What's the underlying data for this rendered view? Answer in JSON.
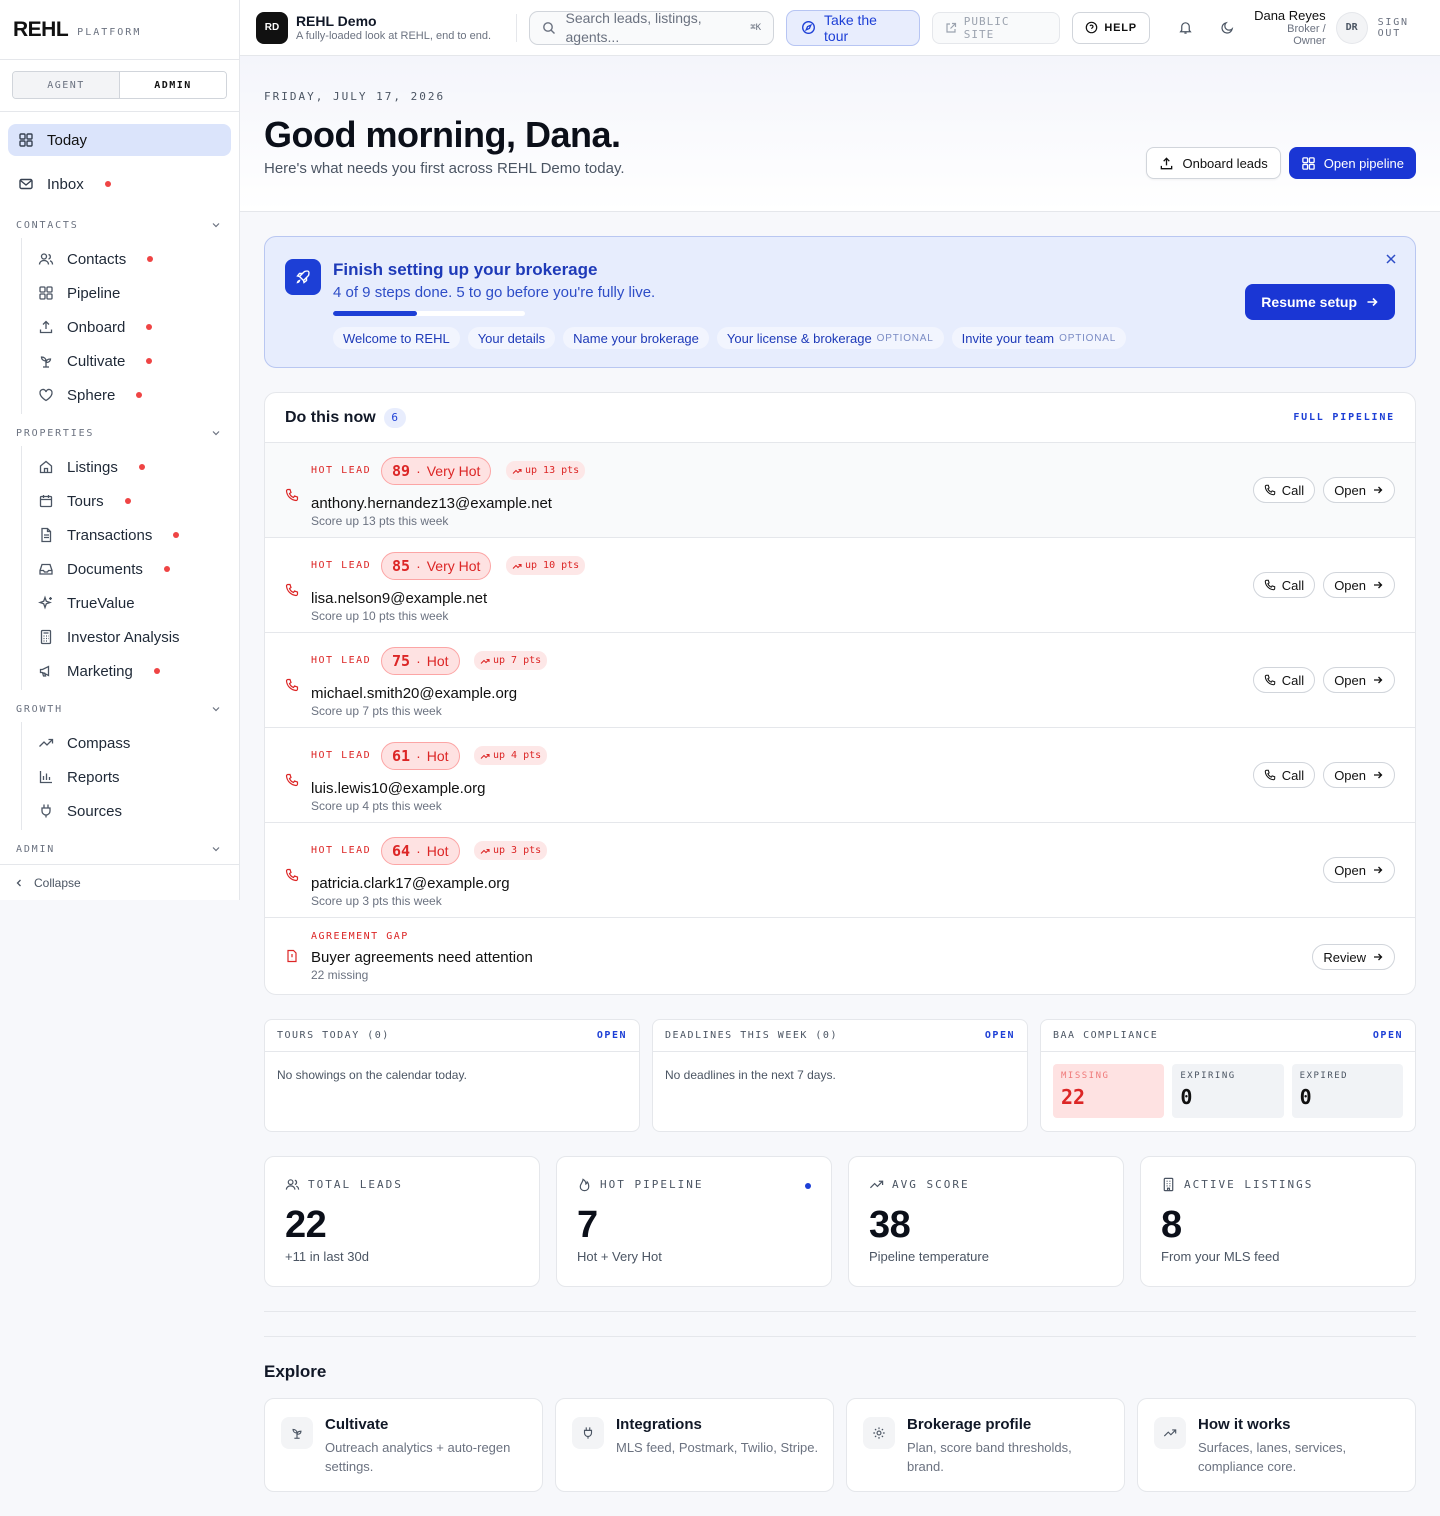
{
  "brand": {
    "logo": "REHL",
    "sub": "PLATFORM"
  },
  "role_toggle": {
    "agent": "AGENT",
    "admin": "ADMIN",
    "selected": "ADMIN"
  },
  "nav": {
    "today": "Today",
    "inbox": "Inbox",
    "sections": {
      "contacts": {
        "label": "CONTACTS",
        "items": [
          "Contacts",
          "Pipeline",
          "Onboard",
          "Cultivate",
          "Sphere"
        ]
      },
      "properties": {
        "label": "PROPERTIES",
        "items": [
          "Listings",
          "Tours",
          "Transactions",
          "Documents",
          "TrueValue",
          "Investor Analysis",
          "Marketing"
        ]
      },
      "growth": {
        "label": "GROWTH",
        "items": [
          "Compass",
          "Reports",
          "Sources"
        ]
      },
      "admin": {
        "label": "ADMIN"
      }
    },
    "collapse": "Collapse"
  },
  "topbar": {
    "org_initials": "RD",
    "org_name": "REHL Demo",
    "org_desc": "A fully-loaded look at REHL, end to end.",
    "search_placeholder": "Search leads, listings, agents...",
    "search_kbd": "⌘K",
    "tour": "Take the tour",
    "public_site": "PUBLIC SITE",
    "help": "HELP",
    "user_name": "Dana Reyes",
    "user_role": "Broker / Owner",
    "user_initials": "DR",
    "sign_out": "SIGN OUT"
  },
  "hero": {
    "date": "FRIDAY, JULY 17, 2026",
    "title": "Good morning, Dana.",
    "subtitle": "Here's what needs you first across REHL Demo today.",
    "onboard": "Onboard leads",
    "open_pipeline": "Open pipeline"
  },
  "setup": {
    "title": "Finish setting up your brokerage",
    "subtitle": "4 of 9 steps done. 5 to go before you're fully live.",
    "progress": 0.44,
    "resume": "Resume setup",
    "chips": [
      {
        "label": "Welcome to REHL",
        "optional": ""
      },
      {
        "label": "Your details",
        "optional": ""
      },
      {
        "label": "Name your brokerage",
        "optional": ""
      },
      {
        "label": "Your license & brokerage",
        "optional": "OPTIONAL"
      },
      {
        "label": "Invite your team",
        "optional": "OPTIONAL"
      }
    ]
  },
  "do_now": {
    "title": "Do this now",
    "count": "6",
    "full_pipeline": "FULL PIPELINE",
    "leads": [
      {
        "tag": "HOT LEAD",
        "score": "89",
        "band": "Very Hot",
        "delta": "up 13 pts",
        "email": "anthony.hernandez13@example.net",
        "note": "Score up 13 pts this week",
        "call": "Call",
        "open": "Open"
      },
      {
        "tag": "HOT LEAD",
        "score": "85",
        "band": "Very Hot",
        "delta": "up 10 pts",
        "email": "lisa.nelson9@example.net",
        "note": "Score up 10 pts this week",
        "call": "Call",
        "open": "Open"
      },
      {
        "tag": "HOT LEAD",
        "score": "75",
        "band": "Hot",
        "delta": "up 7 pts",
        "email": "michael.smith20@example.org",
        "note": "Score up 7 pts this week",
        "call": "Call",
        "open": "Open"
      },
      {
        "tag": "HOT LEAD",
        "score": "61",
        "band": "Hot",
        "delta": "up 4 pts",
        "email": "luis.lewis10@example.org",
        "note": "Score up 4 pts this week",
        "call": "Call",
        "open": "Open"
      },
      {
        "tag": "HOT LEAD",
        "score": "64",
        "band": "Hot",
        "delta": "up 3 pts",
        "email": "patricia.clark17@example.org",
        "note": "Score up 3 pts this week",
        "call": "",
        "open": "Open"
      }
    ],
    "agreement": {
      "tag": "AGREEMENT GAP",
      "title": "Buyer agreements need attention",
      "note": "22 missing",
      "action": "Review"
    }
  },
  "tours": {
    "title": "TOURS TODAY (0)",
    "open": "OPEN",
    "empty": "No showings on the calendar today."
  },
  "deadlines": {
    "title": "DEADLINES THIS WEEK (0)",
    "open": "OPEN",
    "empty": "No deadlines in the next 7 days."
  },
  "baa": {
    "title": "BAA COMPLIANCE",
    "open": "OPEN",
    "missing_label": "MISSING",
    "missing": "22",
    "expiring_label": "EXPIRING",
    "expiring": "0",
    "expired_label": "EXPIRED",
    "expired": "0"
  },
  "stats": [
    {
      "label": "TOTAL LEADS",
      "value": "22",
      "sub": "+11 in last 30d",
      "icon": "users-icon"
    },
    {
      "label": "HOT PIPELINE",
      "value": "7",
      "sub": "Hot + Very Hot",
      "icon": "flame-icon"
    },
    {
      "label": "AVG SCORE",
      "value": "38",
      "sub": "Pipeline temperature",
      "icon": "trending-up-icon"
    },
    {
      "label": "ACTIVE LISTINGS",
      "value": "8",
      "sub": "From your MLS feed",
      "icon": "building-icon"
    }
  ],
  "explore": {
    "title": "Explore",
    "cards": [
      {
        "title": "Cultivate",
        "desc": "Outreach analytics + auto-regen settings.",
        "icon": "sprout-icon"
      },
      {
        "title": "Integrations",
        "desc": "MLS feed, Postmark, Twilio, Stripe.",
        "icon": "plug-icon"
      },
      {
        "title": "Brokerage profile",
        "desc": "Plan, score band thresholds, brand.",
        "icon": "gear-icon"
      },
      {
        "title": "How it works",
        "desc": "Surfaces, lanes, services, compliance core.",
        "icon": "trending-up-icon"
      }
    ]
  },
  "colors": {
    "accent": "#1a36d4",
    "danger": "#dc2626",
    "accent_soft": "#e7edfd"
  }
}
